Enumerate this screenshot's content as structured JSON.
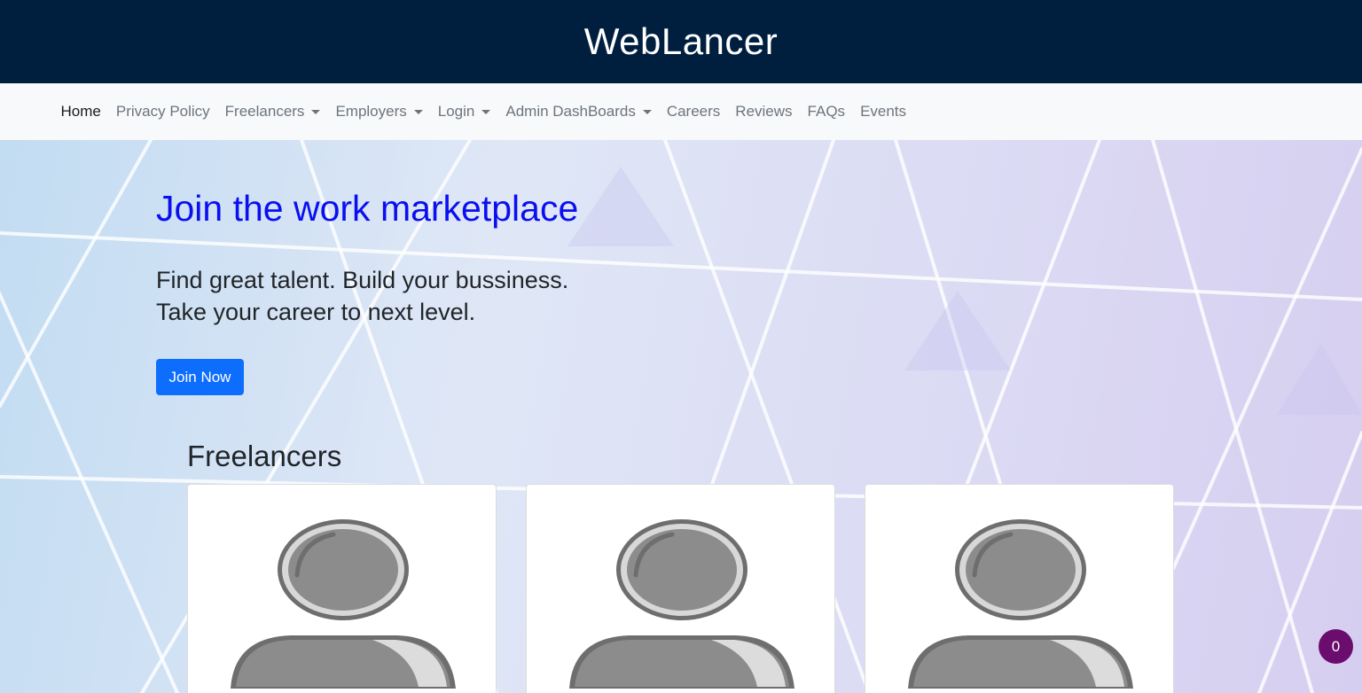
{
  "brand": {
    "title": "WebLancer"
  },
  "nav": {
    "items": [
      {
        "label": "Home",
        "dropdown": false,
        "active": true
      },
      {
        "label": "Privacy Policy",
        "dropdown": false
      },
      {
        "label": "Freelancers",
        "dropdown": true
      },
      {
        "label": "Employers",
        "dropdown": true
      },
      {
        "label": "Login",
        "dropdown": true
      },
      {
        "label": "Admin DashBoards",
        "dropdown": true
      },
      {
        "label": "Careers",
        "dropdown": false
      },
      {
        "label": "Reviews",
        "dropdown": false
      },
      {
        "label": "FAQs",
        "dropdown": false
      },
      {
        "label": "Events",
        "dropdown": false
      }
    ]
  },
  "hero": {
    "title": "Join the work marketplace",
    "subtitle_line1": "Find great talent. Build your bussiness.",
    "subtitle_line2": "Take your career to next level.",
    "button_label": "Join Now"
  },
  "freelancers": {
    "heading": "Freelancers",
    "cards": [
      {
        "avatar_icon": "user-avatar-icon"
      },
      {
        "avatar_icon": "user-avatar-icon"
      },
      {
        "avatar_icon": "user-avatar-icon"
      }
    ]
  },
  "notification": {
    "count": "0"
  },
  "colors": {
    "header_bg": "#001f3f",
    "navbar_bg": "#f8f9fa",
    "hero_title": "#0a0ff0",
    "primary_button": "#0d6efd",
    "badge_bg": "#6a0d6e"
  }
}
